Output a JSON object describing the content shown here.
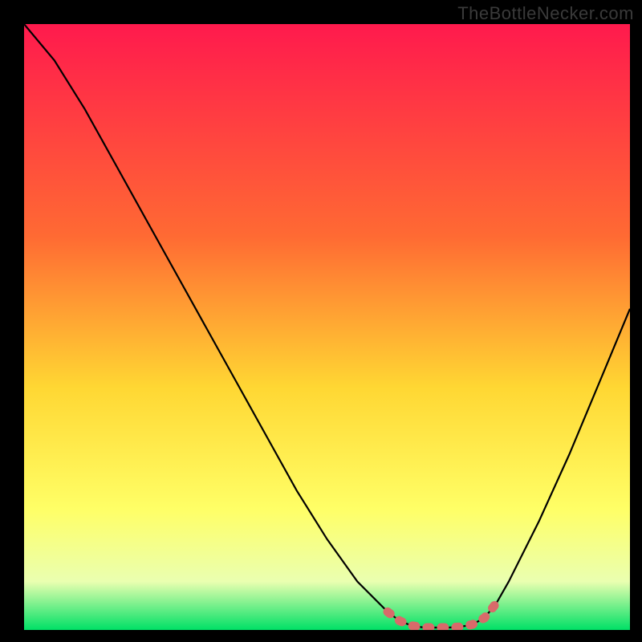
{
  "watermark": "TheBottleNecker.com",
  "chart_data": {
    "type": "line",
    "title": "",
    "xlabel": "",
    "ylabel": "",
    "xlim": [
      0,
      100
    ],
    "ylim": [
      0,
      100
    ],
    "x": [
      0,
      5,
      10,
      15,
      20,
      25,
      30,
      35,
      40,
      45,
      50,
      55,
      60,
      62,
      64,
      66,
      68,
      70,
      72,
      74,
      76,
      78,
      80,
      85,
      90,
      95,
      100
    ],
    "values": [
      102,
      94,
      86,
      77,
      68,
      59,
      50,
      41,
      32,
      23,
      15,
      8,
      3,
      1.5,
      0.7,
      0.4,
      0.4,
      0.4,
      0.5,
      0.9,
      2,
      4.5,
      8,
      18,
      29,
      41,
      53
    ],
    "highlight_x_range": [
      60,
      78
    ],
    "gradient_colors": {
      "top": "#ff1a4d",
      "mid1": "#ff6a33",
      "mid2": "#ffd733",
      "mid3": "#ffff66",
      "mid4": "#eaffb0",
      "bottom": "#00e066"
    },
    "curve_color": "#000000",
    "highlight_color": "#d86a6a"
  }
}
